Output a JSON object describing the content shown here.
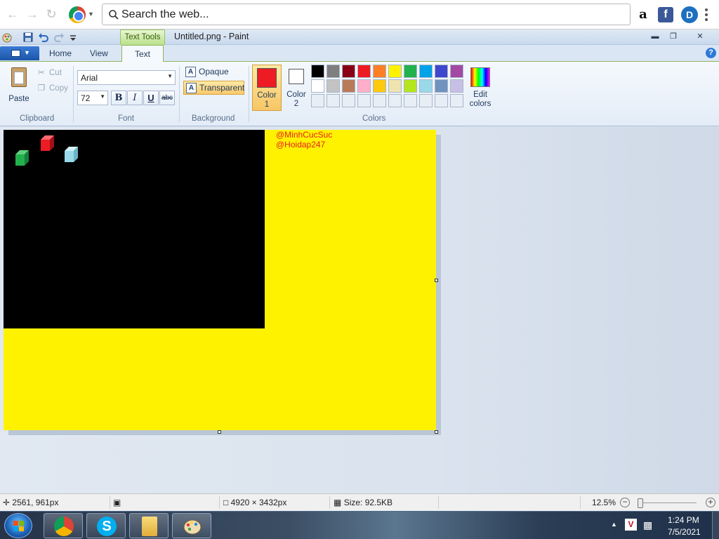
{
  "browser": {
    "search_placeholder": "Search the web..."
  },
  "window": {
    "contextual_tab": "Text Tools",
    "title": "Untitled.png - Paint"
  },
  "ribbon_tabs": [
    "Home",
    "View",
    "Text"
  ],
  "clipboard": {
    "paste": "Paste",
    "cut": "Cut",
    "copy": "Copy",
    "group": "Clipboard"
  },
  "font": {
    "family": "Arial",
    "size": "72",
    "bold": "B",
    "italic": "I",
    "underline": "U",
    "strike": "abc",
    "group": "Font"
  },
  "background": {
    "opaque": "Opaque",
    "transparent": "Transparent",
    "group": "Background"
  },
  "colors": {
    "color1_label": "Color",
    "color1_num": "1",
    "color2_label": "Color",
    "color2_num": "2",
    "color1": "#ed1c24",
    "color2": "#ffffff",
    "edit_label": "Edit",
    "edit_label2": "colors",
    "group": "Colors",
    "palette_row1": [
      "#000000",
      "#7f7f7f",
      "#880015",
      "#ed1c24",
      "#ff7f27",
      "#fff200",
      "#22b14c",
      "#00a2e8",
      "#3f48cc",
      "#a349a4"
    ],
    "palette_row2": [
      "#ffffff",
      "#c3c3c3",
      "#b97a57",
      "#ffaec9",
      "#ffc90e",
      "#efe4b0",
      "#b5e61d",
      "#99d9ea",
      "#7092be",
      "#c8bfe7"
    ]
  },
  "canvas": {
    "background": "#fff200",
    "text_line1": "@MinhCucSuc",
    "text_line2": "@Hoidap247"
  },
  "status": {
    "cursor_pos": "2561, 961px",
    "image_size": "4920 × 3432px",
    "file_size": "Size: 92.5KB",
    "zoom": "12.5%"
  },
  "taskbar": {
    "time": "1:24 PM",
    "date": "7/5/2021"
  }
}
